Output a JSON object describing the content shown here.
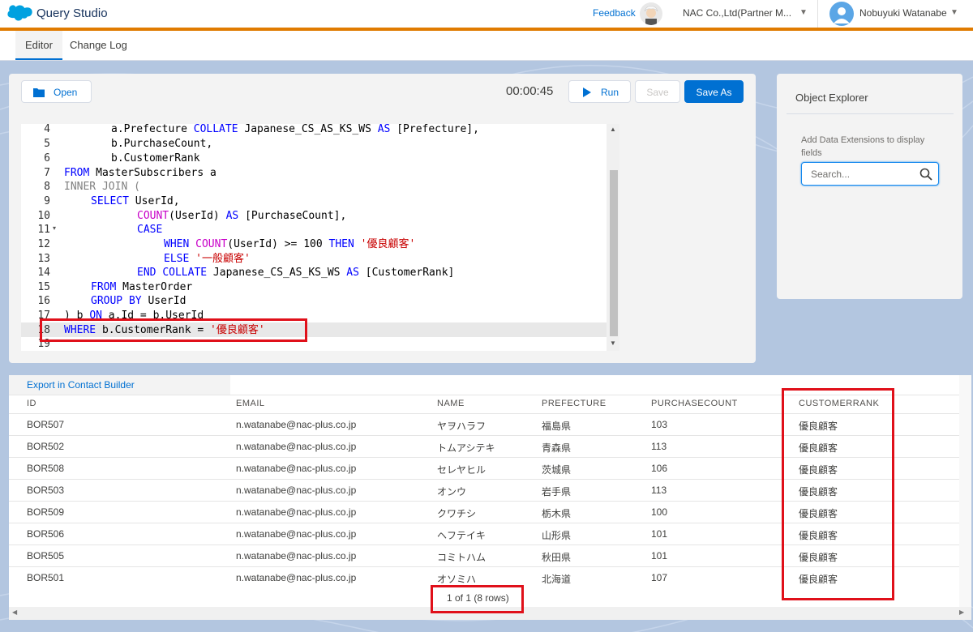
{
  "header": {
    "app_title": "Query Studio",
    "feedback": "Feedback",
    "org_name": "NAC Co.,Ltd(Partner M...",
    "user_name": "Nobuyuki Watanabe"
  },
  "tabs": [
    {
      "label": "Editor",
      "active": true
    },
    {
      "label": "Change Log",
      "active": false
    }
  ],
  "toolbar": {
    "open_label": "Open",
    "timer": "00:00:45",
    "run_label": "Run",
    "save_label": "Save",
    "save_as_label": "Save As"
  },
  "editor": {
    "line_numbers": [
      "4",
      "5",
      "6",
      "7",
      "8",
      "9",
      "10",
      "11",
      "12",
      "13",
      "14",
      "15",
      "16",
      "17",
      "18",
      "19"
    ],
    "lines": [
      "a.Prefecture COLLATE Japanese_CS_AS_KS_WS AS [Prefecture],",
      "b.PurchaseCount,",
      "b.CustomerRank",
      "FROM MasterSubscribers a",
      "INNER JOIN (",
      "SELECT UserId,",
      "COUNT(UserId) AS [PurchaseCount],",
      "CASE",
      "WHEN COUNT(UserId) >= 100 THEN '優良顧客'",
      "ELSE '一般顧客'",
      "END COLLATE Japanese_CS_AS_KS_WS AS [CustomerRank]",
      "FROM MasterOrder",
      "GROUP BY UserId",
      ") b ON a.Id = b.UserId",
      "WHERE b.CustomerRank = '優良顧客'",
      ""
    ]
  },
  "object_explorer": {
    "title": "Object Explorer",
    "hint": "Add Data Extensions to display fields",
    "search_placeholder": "Search..."
  },
  "results": {
    "export_label": "Export in Contact Builder",
    "columns": [
      "ID",
      "EMAIL",
      "NAME",
      "PREFECTURE",
      "PURCHASECOUNT",
      "CUSTOMERRANK"
    ],
    "rows": [
      [
        "BOR507",
        "n.watanabe@nac-plus.co.jp",
        "ヤヲハラフ",
        "福島県",
        "103",
        "優良顧客"
      ],
      [
        "BOR502",
        "n.watanabe@nac-plus.co.jp",
        "トムアシテキ",
        "青森県",
        "113",
        "優良顧客"
      ],
      [
        "BOR508",
        "n.watanabe@nac-plus.co.jp",
        "セレヤヒル",
        "茨城県",
        "106",
        "優良顧客"
      ],
      [
        "BOR503",
        "n.watanabe@nac-plus.co.jp",
        "オンウ",
        "岩手県",
        "113",
        "優良顧客"
      ],
      [
        "BOR509",
        "n.watanabe@nac-plus.co.jp",
        "クワチシ",
        "栃木県",
        "100",
        "優良顧客"
      ],
      [
        "BOR506",
        "n.watanabe@nac-plus.co.jp",
        "ヘフテイキ",
        "山形県",
        "101",
        "優良顧客"
      ],
      [
        "BOR505",
        "n.watanabe@nac-plus.co.jp",
        "コミトハム",
        "秋田県",
        "101",
        "優良顧客"
      ],
      [
        "BOR501",
        "n.watanabe@nac-plus.co.jp",
        "オソミハ",
        "北海道",
        "107",
        "優良顧客"
      ]
    ],
    "pager": "1 of 1 (8 rows)"
  },
  "colors": {
    "brand": "#0070d2",
    "accent_line": "#e07b00",
    "highlight_red": "#e0101a"
  }
}
